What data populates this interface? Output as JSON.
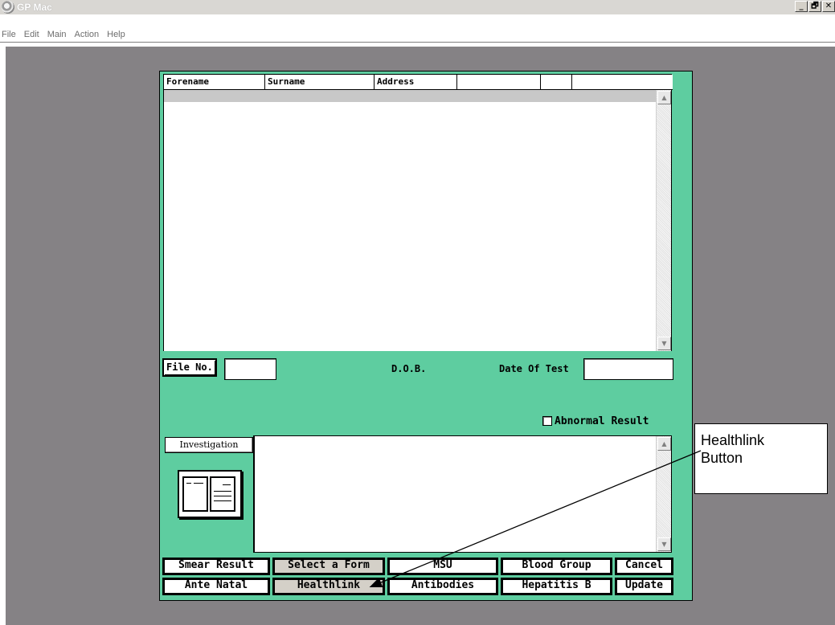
{
  "window": {
    "title": "GP Mac",
    "controls": {
      "minimize": "_",
      "restore": "🗗",
      "close": "✕"
    }
  },
  "menu": [
    "File",
    "Edit",
    "Main",
    "Action",
    "Help"
  ],
  "grid": {
    "columns": [
      "Forename",
      "Surname",
      "Address",
      "",
      "",
      ""
    ]
  },
  "fields": {
    "file_no_label": "File No.",
    "dob_label": "D.O.B.",
    "date_of_test_label": "Date Of Test",
    "abnormal_result_label": "Abnormal Result",
    "investigation_label": "Investigation"
  },
  "buttons": {
    "smear_result": "Smear Result",
    "select_a_form": "Select a Form",
    "msu": "MSU",
    "blood_group": "Blood Group",
    "cancel": "Cancel",
    "ante_natal": "Ante Natal",
    "healthlink": "Healthlink",
    "antibodies": "Antibodies",
    "hepatitis_b": "Hepatitis B",
    "update": "Update"
  },
  "annotation": {
    "line1": "Healthlink",
    "line2": "Button"
  },
  "colors": {
    "form_bg": "#5ecda0",
    "mdi_bg": "#858285"
  }
}
